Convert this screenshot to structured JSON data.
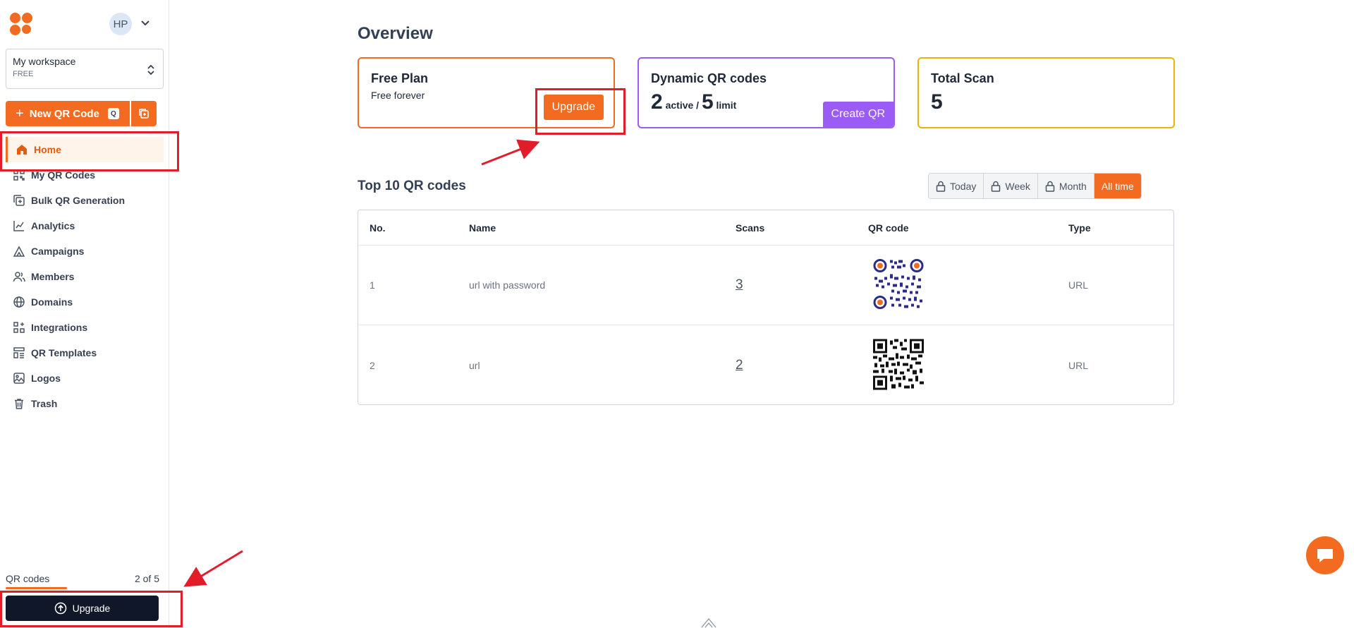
{
  "sidebar": {
    "avatar_initials": "HP",
    "workspace": {
      "name": "My workspace",
      "plan": "FREE"
    },
    "new_qr": {
      "label": "New QR Code",
      "shortcut": "Q"
    },
    "items": [
      {
        "label": "Home",
        "icon": "home-icon",
        "active": true
      },
      {
        "label": "My QR Codes",
        "icon": "qr-grid-icon"
      },
      {
        "label": "Bulk QR Generation",
        "icon": "bulk-copy-icon"
      },
      {
        "label": "Analytics",
        "icon": "analytics-icon"
      },
      {
        "label": "Campaigns",
        "icon": "campaign-icon"
      },
      {
        "label": "Members",
        "icon": "members-icon"
      },
      {
        "label": "Domains",
        "icon": "globe-icon"
      },
      {
        "label": "Integrations",
        "icon": "integrations-icon"
      },
      {
        "label": "QR Templates",
        "icon": "templates-icon"
      },
      {
        "label": "Logos",
        "icon": "image-icon"
      },
      {
        "label": "Trash",
        "icon": "trash-icon"
      }
    ],
    "quota": {
      "label": "QR codes",
      "value": "2 of 5",
      "fraction": 0.4
    },
    "upgrade_label": "Upgrade"
  },
  "main": {
    "title": "Overview",
    "cards": {
      "plan": {
        "title": "Free Plan",
        "subtitle": "Free forever",
        "button": "Upgrade"
      },
      "dynamic": {
        "title": "Dynamic QR codes",
        "active_count": "2",
        "active_label": "active /",
        "limit_count": "5",
        "limit_label": "limit",
        "button": "Create QR"
      },
      "scans": {
        "title": "Total Scan",
        "value": "5"
      }
    },
    "top10": {
      "title": "Top 10 QR codes",
      "filters": [
        "Today",
        "Week",
        "Month",
        "All time"
      ],
      "active_filter": "All time",
      "columns": [
        "No.",
        "Name",
        "Scans",
        "QR code",
        "Type"
      ],
      "rows": [
        {
          "no": "1",
          "name": "url with password",
          "scans": "3",
          "type": "URL"
        },
        {
          "no": "2",
          "name": "url",
          "scans": "2",
          "type": "URL"
        }
      ]
    }
  },
  "colors": {
    "accent": "#f26b21",
    "purple": "#9b5cf6",
    "yellow": "#eab308",
    "dark": "#0f1729",
    "highlight": "#e11d2a"
  }
}
